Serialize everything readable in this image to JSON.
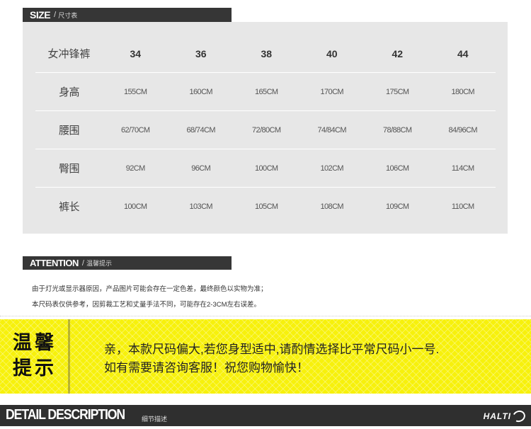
{
  "size_section": {
    "title": "SIZE",
    "separator": "/",
    "subtitle": "尺寸表"
  },
  "size_table": {
    "header_label": "女冲锋裤",
    "sizes": [
      "34",
      "36",
      "38",
      "40",
      "42",
      "44"
    ],
    "rows": [
      {
        "label": "身高",
        "values": [
          "155CM",
          "160CM",
          "165CM",
          "170CM",
          "175CM",
          "180CM"
        ]
      },
      {
        "label": "腰围",
        "values": [
          "62/70CM",
          "68/74CM",
          "72/80CM",
          "74/84CM",
          "78/88CM",
          "84/96CM"
        ]
      },
      {
        "label": "臀围",
        "values": [
          "92CM",
          "96CM",
          "100CM",
          "102CM",
          "106CM",
          "114CM"
        ]
      },
      {
        "label": "裤长",
        "values": [
          "100CM",
          "103CM",
          "105CM",
          "108CM",
          "109CM",
          "110CM"
        ]
      }
    ]
  },
  "attention_section": {
    "title": "ATTENTION",
    "separator": "/",
    "subtitle": "温馨提示",
    "notes": [
      "由于灯光或显示器原因，产品图片可能会存在一定色差，最终颜色以实物为准；",
      "本尺码表仅供参考，因剪裁工艺和丈量手法不同，可能存在2-3CM左右误差。"
    ]
  },
  "banner": {
    "title_line1": "温馨",
    "title_line2": "提示",
    "line1": "亲，本款尺码偏大,若您身型适中,请酌情选择比平常尺码小一号.",
    "line2": "如有需要请咨询客服！祝您购物愉快！",
    "bg_color": "#f7f10c"
  },
  "detail_section": {
    "title": "DETAIL DESCRIPTION",
    "subtitle": "细节描述",
    "logo_text": "HALTI"
  }
}
